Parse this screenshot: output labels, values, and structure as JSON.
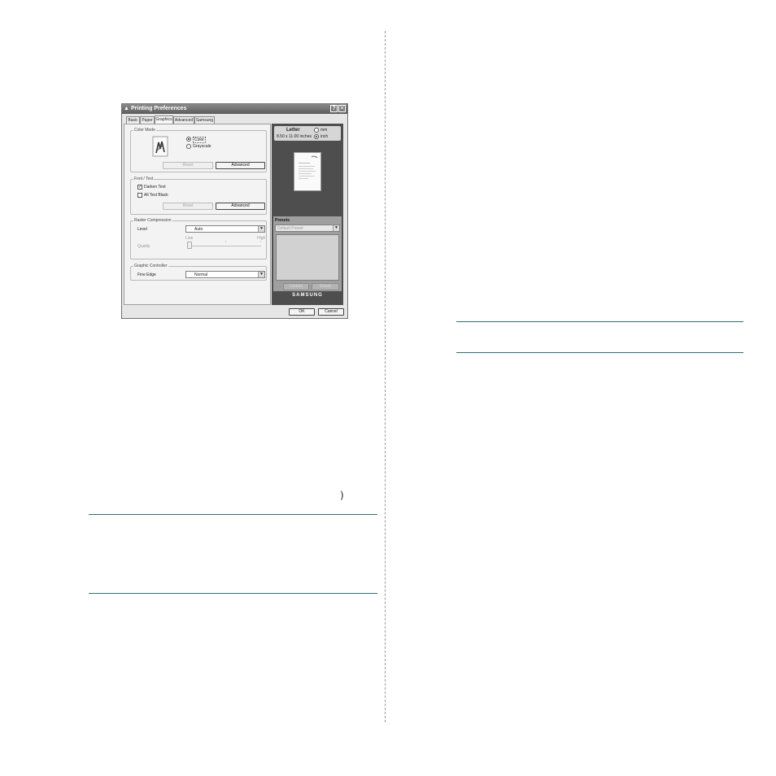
{
  "page": {
    "closing_paren": ")"
  },
  "dialog": {
    "title": "Printing Preferences",
    "help_glyph": "?",
    "close_glyph": "✕",
    "tabs": [
      {
        "label": "Basic",
        "active": false
      },
      {
        "label": "Paper",
        "active": false
      },
      {
        "label": "Graphics",
        "active": true
      },
      {
        "label": "Advanced",
        "active": false
      },
      {
        "label": "Samsung",
        "active": false
      }
    ],
    "color_mode": {
      "group_label": "Color Mode",
      "options": [
        {
          "label": "Color",
          "selected": true
        },
        {
          "label": "Grayscale",
          "selected": false
        }
      ],
      "reset_label": "Reset",
      "advanced_label": "Advanced"
    },
    "font_text": {
      "group_label": "Font / Text",
      "darken_text": {
        "label": "Darken Text",
        "checked": true
      },
      "all_text_black": {
        "label": "All Text Black",
        "checked": false
      },
      "reset_label": "Reset",
      "advanced_label": "Advanced"
    },
    "raster": {
      "group_label": "Raster Compression",
      "level_label": "Level",
      "level_value": "Auto",
      "low_label": "Low",
      "high_label": "High",
      "quality_label": "Quality",
      "quality_level": 0
    },
    "graphic_controller": {
      "group_label": "Graphic Controller",
      "fine_edge_label": "Fine Edge",
      "fine_edge_value": "Normal"
    },
    "preview": {
      "paper_name": "Letter",
      "paper_size": "8.50 x 11.00 inches",
      "unit_mm": "mm",
      "unit_inch": "inch",
      "unit_selected": "inch"
    },
    "presets": {
      "label": "Presets",
      "selected": "Default Preset",
      "update_label": "Update",
      "delete_label": "Delete"
    },
    "brand": "SAMSUNG",
    "ok_label": "OK",
    "cancel_label": "Cancel"
  }
}
